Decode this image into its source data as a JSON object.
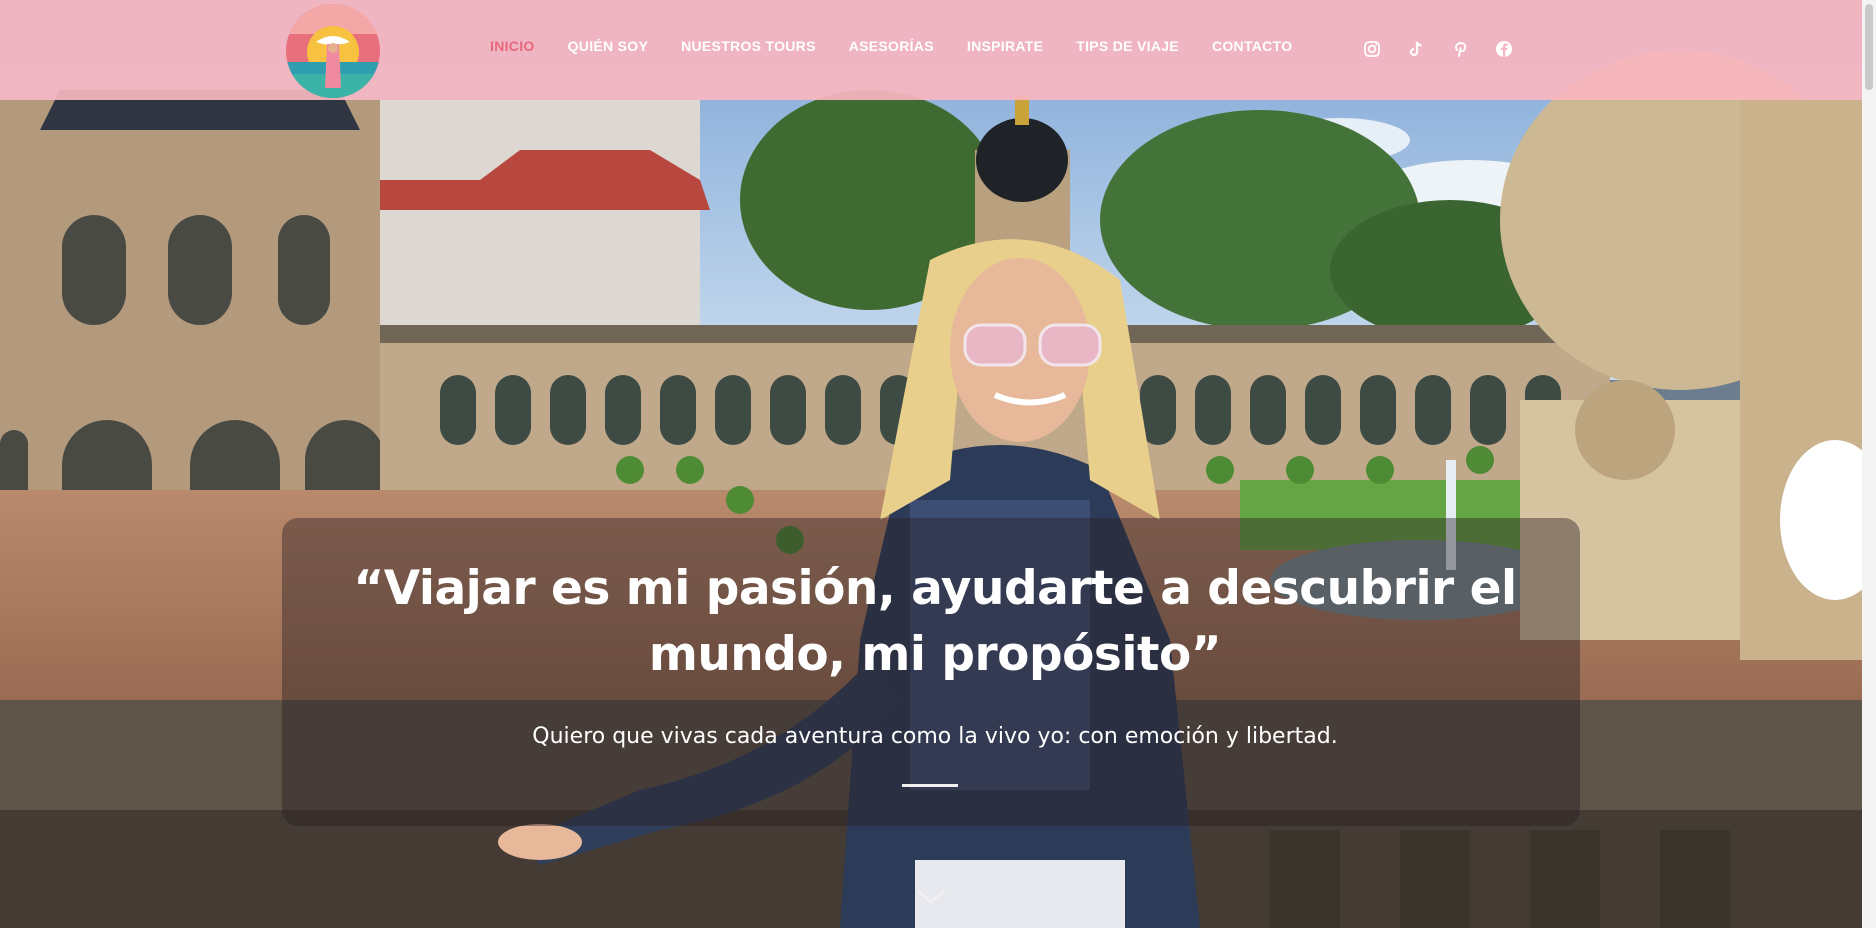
{
  "nav": {
    "items": [
      {
        "label": "INICIO",
        "active": true
      },
      {
        "label": "QUIÉN SOY",
        "active": false
      },
      {
        "label": "NUESTROS TOURS",
        "active": false
      },
      {
        "label": "ASESORÍAS",
        "active": false
      },
      {
        "label": "INSPIRATE",
        "active": false
      },
      {
        "label": "TIPS DE VIAJE",
        "active": false
      },
      {
        "label": "CONTACTO",
        "active": false
      }
    ]
  },
  "social": [
    "instagram-icon",
    "tiktok-icon",
    "pinterest-icon",
    "facebook-icon"
  ],
  "hero": {
    "quote": "“Viajar es mi pasión, ayudarte a descubrir el mundo, mi propósito”",
    "subtitle": "Quiero que vivas cada aventura como la vivo yo: con emoción y libertad."
  },
  "colors": {
    "header_bg": "#f7b6c0",
    "nav_active": "#e8677a",
    "nav_text": "#ffffff"
  }
}
